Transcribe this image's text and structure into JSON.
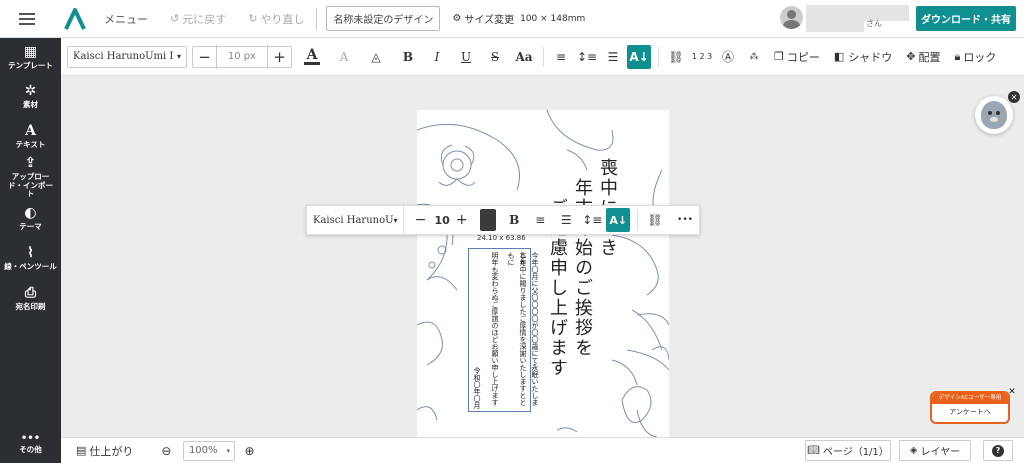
{
  "header": {
    "menu_label": "メニュー",
    "undo_label": "元に戻す",
    "redo_label": "やり直し",
    "design_name": "名称未設定のデザイン",
    "size_label": "サイズ変更",
    "size_value": "100 × 148mm",
    "user_suffix": "さん",
    "download_label": "ダウンロード・共有"
  },
  "sidebar": {
    "items": [
      {
        "label": "テンプレート",
        "icon": "template-icon"
      },
      {
        "label": "素材",
        "icon": "materials-icon"
      },
      {
        "label": "テキスト",
        "icon": "text-icon"
      },
      {
        "label": "アップロード・インポート",
        "icon": "upload-icon"
      },
      {
        "label": "テーマ",
        "icon": "palette-icon"
      },
      {
        "label": "線・ペンツール",
        "icon": "pen-tool-icon"
      },
      {
        "label": "宛名印刷",
        "icon": "print-icon"
      }
    ],
    "more_label": "その他"
  },
  "format_bar": {
    "font_name": "Kaisci HarunoUmi I",
    "font_size": "10 px",
    "copy_label": "コピー",
    "shadow_label": "シャドウ",
    "arrange_label": "配置",
    "lock_label": "ロック",
    "number_label": "1 2 3"
  },
  "float_toolbar": {
    "font_name": "Kaisci HarunoUmi Regu",
    "font_size": "10",
    "dimension": "24.10 x 63.86"
  },
  "card": {
    "title_lines": [
      "喪中につき",
      "年末年始のご挨拶を",
      "ご遠慮申し上げます"
    ],
    "body_lines": [
      "今年〇月に父〇〇〇〇が〇〇歳にて永眠いたしました",
      "本年中に賜りましたご厚情を深謝いたしますとともに",
      "明年も変わらぬご厚誼のほどお願い申し上げます"
    ],
    "date": "令和〇年〇月"
  },
  "bottom": {
    "finish_label": "仕上がり",
    "zoom": "100%",
    "page_label": "ページ（1/1）",
    "layer_label": "レイヤー",
    "help_label": "?"
  },
  "survey": {
    "tag": "デザインACユーザー専用",
    "label": "アンケートへ"
  },
  "colors": {
    "accent": "#0f8f8f",
    "sidebar": "#2b2e33",
    "text_color_swatch": "#3a3a3a"
  }
}
